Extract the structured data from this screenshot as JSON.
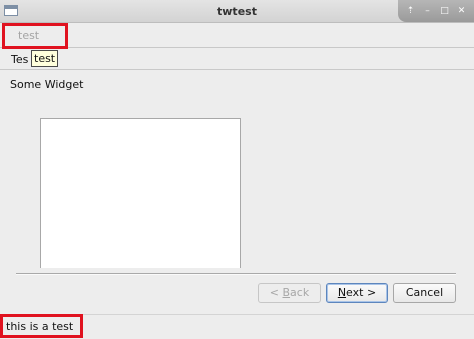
{
  "window": {
    "title": "twtest",
    "controls": {
      "shade_glyph": "⇡",
      "minimize_glyph": "–",
      "maximize_glyph": "□",
      "close_glyph": "✕"
    }
  },
  "toolbar": {
    "menu_label": "test"
  },
  "tabs": {
    "label": "Tes",
    "tooltip": "test"
  },
  "page": {
    "title": "Some Widget"
  },
  "buttons": {
    "back": {
      "prefix": "< ",
      "mnemonic": "B",
      "rest": "ack",
      "enabled": false
    },
    "next": {
      "mnemonic": "N",
      "rest": "ext >",
      "enabled": true
    },
    "cancel": {
      "label": "Cancel",
      "enabled": true
    }
  },
  "status": {
    "text": "this is a test"
  },
  "colors": {
    "highlight": "#e0121f",
    "tooltip_bg": "#ffffdc",
    "default_button_border": "#5d86bd"
  }
}
